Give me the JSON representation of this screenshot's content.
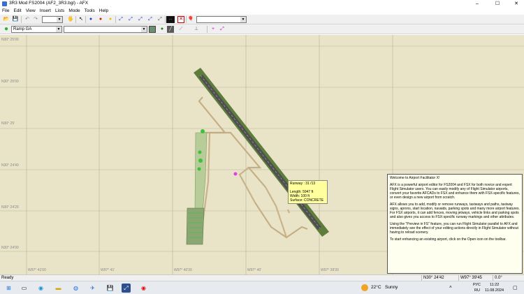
{
  "window": {
    "title": "3R3 Mod FS2004 (AF2_3R3.bgl) - AFX",
    "minimize": "–",
    "maximize": "☐",
    "close": "✕"
  },
  "menu": [
    "File",
    "Edit",
    "View",
    "Insert",
    "Lists",
    "Mode",
    "Tools",
    "Help"
  ],
  "toolbar2": {
    "layer_value": "Ramp GA",
    "second_combo_value": ""
  },
  "map": {
    "latitudes": [
      "N30° 25'00",
      "N30° 25'00",
      "N30° 25'",
      "N30° 24'40",
      "N30° 24'20",
      "N30° 24'00"
    ],
    "longitudes": [
      "W97° 41'00",
      "W97° 41'",
      "W97° 40'30",
      "W97° 40'",
      "W97° 39'30"
    ]
  },
  "tooltip": {
    "runway": "Runway : 31 /13",
    "length": "Length: 5947 ft",
    "width": "Width: 100 ft",
    "surface": "Surface: CONCRETE"
  },
  "welcome": {
    "title": "Welcome to Airport Facilitator X!",
    "p1": "AFX is a powerful airport editor for FS2004 and FSX for both novice and expert Flight Simulator users. You can easily modify any of Flight Simulator airports, convert your favorite AFCADs to FSX and enhance them with FSX-specific features, or even design a new airport from scratch.",
    "p2": "AFX allows you to add, modify or remove runways, taxiways and paths, taxiway signs, aprons, start location, navaids, parking spots and many more airport features. For FSX airports, it can add fences, moving jetways, vehicle links and parking spots and also gives you access to FSX-specific runway markings and other attributes.",
    "p3": "Using the \"Preview in FS\" feature, you can run Flight Simulator parallel to AFX and immediately see the effect of your editing actions directly in Flight Simulator without having to reload scenery.",
    "p4": "To start enhancing an existing airport, click on the Open icon on the toolbar."
  },
  "status": {
    "text": "Ready",
    "lat": "N30° 24'42",
    "lon": "W97° 39'45",
    "angle": "0.0°"
  },
  "taskbar": {
    "weather_temp": "22°C",
    "weather_text": "Sunny",
    "lang_top": "РУС",
    "lang_bottom": "RU",
    "time": "11:22",
    "date": "11.08.2024"
  },
  "colors": {
    "runway": "#5e7d3c",
    "taxiway": "#c9b48a",
    "map_bg": "#e9e3c8",
    "grid": "#b9b39d"
  }
}
